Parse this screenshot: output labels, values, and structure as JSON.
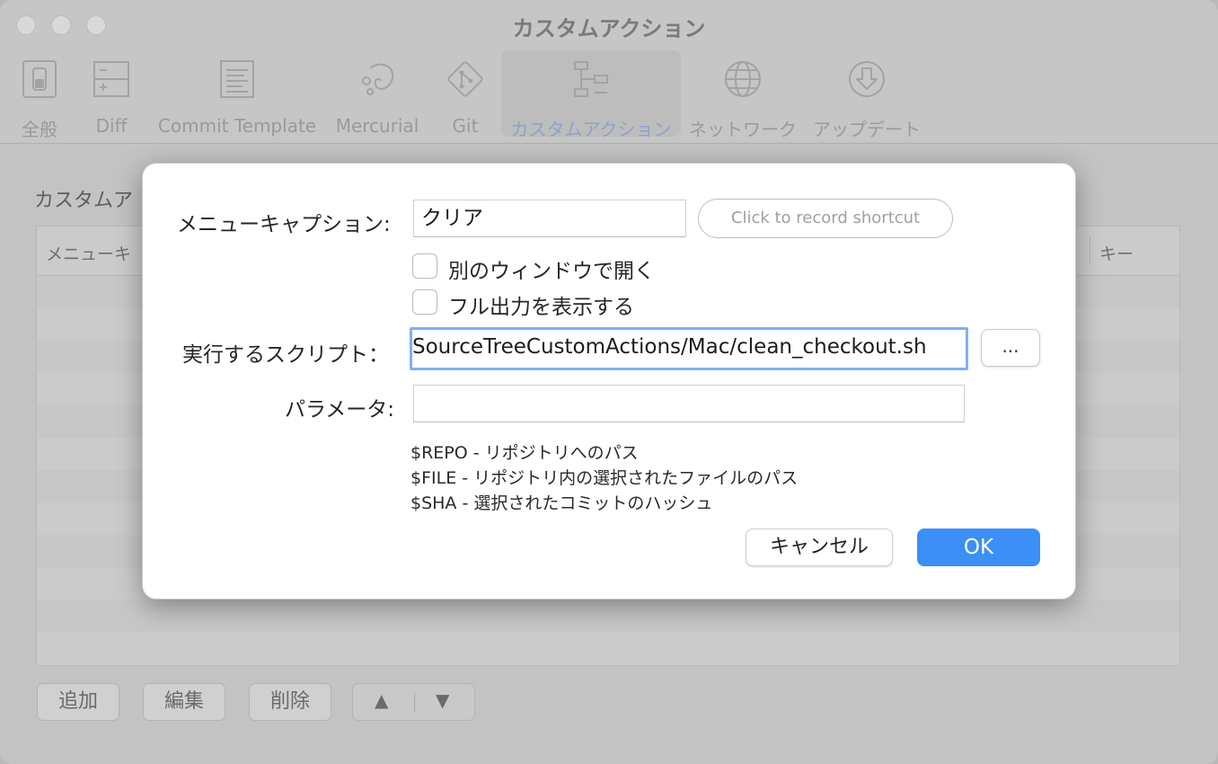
{
  "window": {
    "title": "カスタムアクション"
  },
  "toolbar": {
    "items": [
      {
        "label": "全般",
        "icon": "switch-icon"
      },
      {
        "label": "Diff",
        "icon": "diff-icon"
      },
      {
        "label": "Commit Template",
        "icon": "document-icon"
      },
      {
        "label": "Mercurial",
        "icon": "mercurial-icon"
      },
      {
        "label": "Git",
        "icon": "git-icon"
      },
      {
        "label": "カスタムアクション",
        "icon": "flow-icon",
        "active": true
      },
      {
        "label": "ネットワーク",
        "icon": "globe-icon"
      },
      {
        "label": "アップデート",
        "icon": "download-icon"
      }
    ]
  },
  "main": {
    "section_title": "カスタムア",
    "table": {
      "columns": [
        "メニューキ",
        "キー"
      ]
    },
    "buttons": {
      "add": "追加",
      "edit": "編集",
      "delete": "削除",
      "up": "▲",
      "down": "▼"
    }
  },
  "dialog": {
    "caption_label": "メニューキャプション:",
    "caption_value": "クリア",
    "shortcut_placeholder": "Click to record shortcut",
    "open_new_window_label": "別のウィンドウで開く",
    "show_full_output_label": "フル出力を表示する",
    "script_label": "実行するスクリプト：",
    "script_value": "SourceTreeCustomActions/Mac/clean_checkout.sh",
    "browse_label": "...",
    "params_label": "パラメータ:",
    "params_value": "",
    "help_lines": [
      "$REPO - リポジトリへのパス",
      "$FILE - リポジトリ内の選択されたファイルのパス",
      "$SHA - 選択されたコミットのハッシュ"
    ],
    "cancel_label": "キャンセル",
    "ok_label": "OK"
  },
  "colors": {
    "accent": "#3b8ff7",
    "focus_ring": "#7fb0f2"
  }
}
